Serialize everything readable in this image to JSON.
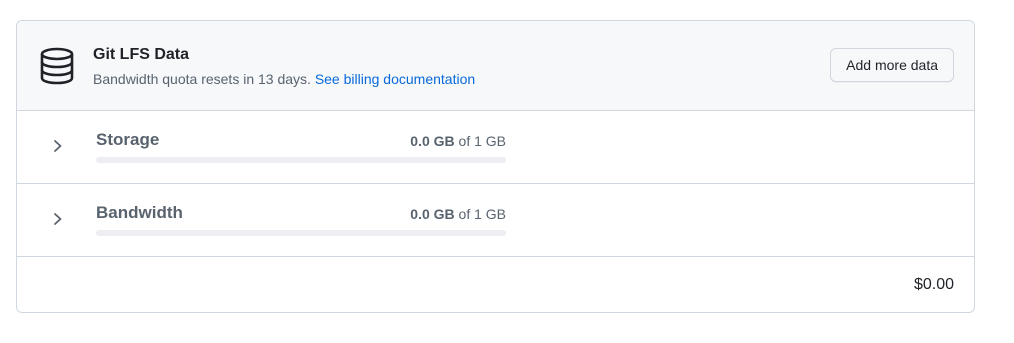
{
  "header": {
    "icon": "database-icon",
    "title": "Git LFS Data",
    "subtitle": "Bandwidth quota resets in 13 days.",
    "link_label": "See billing documentation",
    "button_label": "Add more data"
  },
  "rows": [
    {
      "label": "Storage",
      "used": "0.0 GB",
      "of_text": "of 1 GB",
      "progress_fraction": 0
    },
    {
      "label": "Bandwidth",
      "used": "0.0 GB",
      "of_text": "of 1 GB",
      "progress_fraction": 0
    }
  ],
  "footer": {
    "total": "$0.00"
  },
  "colors": {
    "accent_link": "#0969da",
    "border": "#d0d7de",
    "header_bg": "#f6f8fa",
    "progress_track": "#eceef1"
  }
}
